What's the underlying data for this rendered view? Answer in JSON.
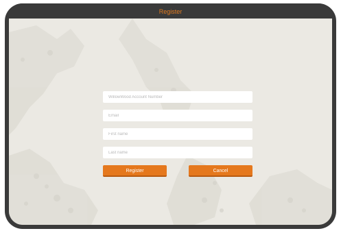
{
  "header": {
    "title": "Register"
  },
  "form": {
    "account_number_placeholder": "WillowWood Account Number",
    "email_placeholder": "Email",
    "first_name_placeholder": "First name",
    "last_name_placeholder": "Last name",
    "register_label": "Register",
    "cancel_label": "Cancel"
  },
  "colors": {
    "accent": "#e5781d",
    "title": "#e07a1f",
    "frame": "#3a3a3a",
    "background": "#ebe9e3"
  }
}
